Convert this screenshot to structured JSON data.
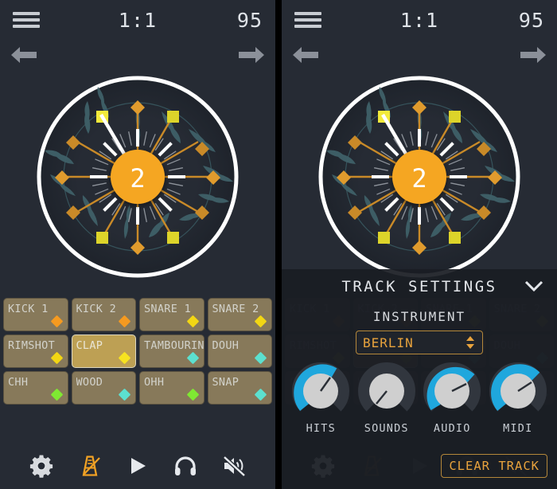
{
  "colors": {
    "bg": "#262b34",
    "panel_overlay": "#1a1d23",
    "accent_orange": "#f5a623",
    "accent_gold": "#e8a33d",
    "knob_blue": "#1fa7dd",
    "pad_bg": "#87795a",
    "pad_selected": "#bda054",
    "text_light": "#dfe3e8",
    "waveform_teal": "#3f6068"
  },
  "header": {
    "menu_icon": "hamburger-icon",
    "title": "1:1",
    "tempo": "95",
    "prev_icon": "arrow-left-icon",
    "next_icon": "arrow-right-icon"
  },
  "wheel": {
    "step_label": "2",
    "playhead_angle_deg": -45,
    "markers": [
      {
        "angle": 0,
        "shape": "diamond",
        "color": "#e09b2d"
      },
      {
        "angle": 30,
        "shape": "square",
        "color": "#ddd42a"
      },
      {
        "angle": 60,
        "shape": "diamond",
        "color": "#e09b2d"
      },
      {
        "angle": 90,
        "shape": "diamond",
        "color": "#e09b2d"
      },
      {
        "angle": 120,
        "shape": "diamond",
        "color": "#c98a28"
      },
      {
        "angle": 150,
        "shape": "square",
        "color": "#ddd42a"
      },
      {
        "angle": 180,
        "shape": "diamond",
        "color": "#e09b2d"
      },
      {
        "angle": 210,
        "shape": "square",
        "color": "#ddd42a"
      },
      {
        "angle": 240,
        "shape": "diamond",
        "color": "#c98a28"
      },
      {
        "angle": 270,
        "shape": "diamond",
        "color": "#e09b2d"
      },
      {
        "angle": 300,
        "shape": "diamond",
        "color": "#c98a28"
      },
      {
        "angle": 330,
        "shape": "square",
        "color": "#ddd42a"
      }
    ],
    "tick_count": 32,
    "accent_ticks": [
      0,
      4,
      8,
      12,
      16,
      20,
      24,
      28
    ]
  },
  "pads": [
    {
      "label": "KICK 1",
      "dot": "#f59a20",
      "selected": false
    },
    {
      "label": "KICK 2",
      "dot": "#f59a20",
      "selected": false
    },
    {
      "label": "SNARE 1",
      "dot": "#f2d614",
      "selected": false
    },
    {
      "label": "SNARE 2",
      "dot": "#f2d614",
      "selected": false
    },
    {
      "label": "RIMSHOT",
      "dot": "#f2d614",
      "selected": false
    },
    {
      "label": "CLAP",
      "dot": "#f7e320",
      "selected": true
    },
    {
      "label": "TAMBOURIN",
      "dot": "#5ce0cf",
      "selected": false
    },
    {
      "label": "DOUH",
      "dot": "#5ce0cf",
      "selected": false
    },
    {
      "label": "CHH",
      "dot": "#7fe832",
      "selected": false
    },
    {
      "label": "WOOD",
      "dot": "#5ce0cf",
      "selected": false
    },
    {
      "label": "OHH",
      "dot": "#7fe832",
      "selected": false
    },
    {
      "label": "SNAP",
      "dot": "#5ce0cf",
      "selected": false
    }
  ],
  "toolbar": {
    "settings_icon": "gear-icon",
    "metronome_icon": "metronome-icon",
    "play_icon": "play-icon",
    "headphones_icon": "headphones-icon",
    "mute_icon": "speaker-muted-icon",
    "metronome_active": true
  },
  "track_settings": {
    "title": "TRACK SETTINGS",
    "collapse_icon": "chevron-down-icon",
    "instrument_label": "INSTRUMENT",
    "instrument_value": "BERLIN",
    "stepper_icon": "stepper-updown-icon",
    "knobs": [
      {
        "label": "HITS",
        "value": 78,
        "active": true
      },
      {
        "label": "SOUNDS",
        "value": 0,
        "active": false
      },
      {
        "label": "AUDIO",
        "value": 86,
        "active": true
      },
      {
        "label": "MIDI",
        "value": 82,
        "active": true
      }
    ],
    "clear_track_label": "CLEAR TRACK"
  }
}
